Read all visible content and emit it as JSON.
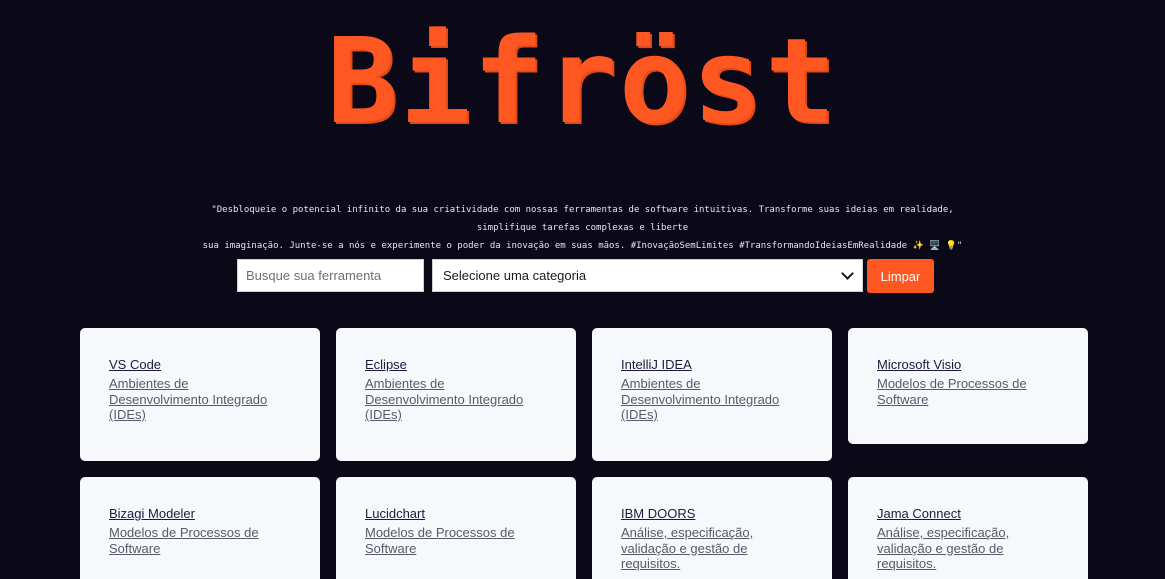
{
  "brand": {
    "title": "Bifröst",
    "color": "#ff5722"
  },
  "tagline": {
    "line1": "\"Desbloqueie o potencial infinito da sua criatividade com nossas ferramentas de software intuitivas. Transforme suas ideias em realidade, simplifique tarefas complexas e liberte",
    "line2": "sua imaginação. Junte-se a nós e experimente o poder da inovação em suas mãos. #InovaçãoSemLimites #TransformandoIdeiasEmRealidade ✨ 🖥️ 💡\""
  },
  "search": {
    "placeholder": "Busque sua ferramenta",
    "value": ""
  },
  "category_select": {
    "selected": "Selecione uma categoria"
  },
  "clear_button": {
    "label": "Limpar"
  },
  "tools": [
    {
      "name": "VS Code",
      "category": "Ambientes de Desenvolvimento Integrado (IDEs)"
    },
    {
      "name": "Eclipse",
      "category": "Ambientes de Desenvolvimento Integrado (IDEs)"
    },
    {
      "name": "IntelliJ IDEA",
      "category": "Ambientes de Desenvolvimento Integrado (IDEs)"
    },
    {
      "name": "Microsoft Visio",
      "category": "Modelos de Processos de Software"
    },
    {
      "name": "Bizagi Modeler",
      "category": "Modelos de Processos de Software"
    },
    {
      "name": "Lucidchart",
      "category": "Modelos de Processos de Software"
    },
    {
      "name": "IBM DOORS",
      "category": "Análise, especificação, validação e gestão de requisitos."
    },
    {
      "name": "Jama Connect",
      "category": "Análise, especificação, validação e gestão de requisitos."
    }
  ],
  "colors": {
    "background": "#0b0817",
    "accent": "#ff5722",
    "card": "#f7f8fb"
  }
}
